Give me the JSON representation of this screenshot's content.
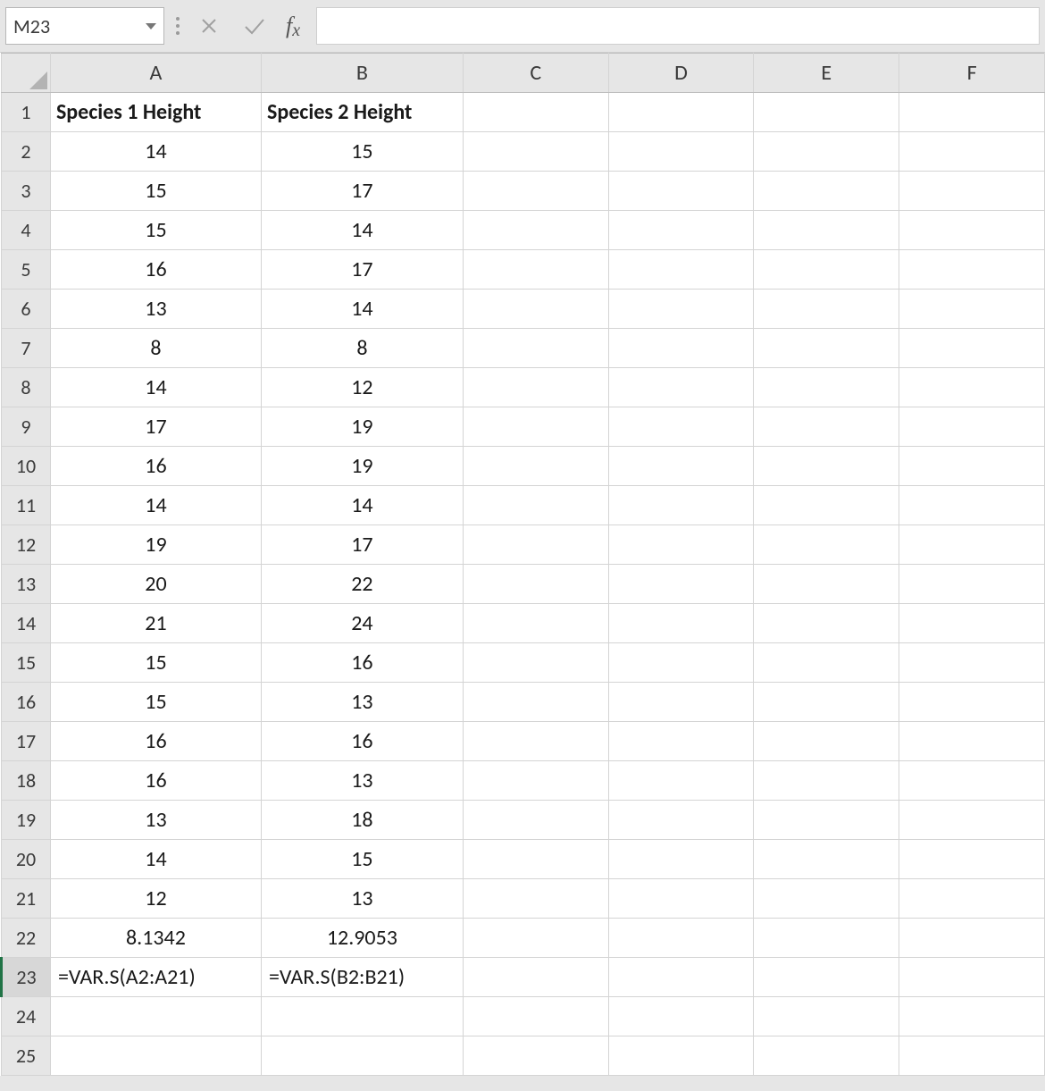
{
  "name_box": "M23",
  "formula_input": "",
  "columns": [
    "A",
    "B",
    "C",
    "D",
    "E",
    "F"
  ],
  "row_numbers": [
    "1",
    "2",
    "3",
    "4",
    "5",
    "6",
    "7",
    "8",
    "9",
    "10",
    "11",
    "12",
    "13",
    "14",
    "15",
    "16",
    "17",
    "18",
    "19",
    "20",
    "21",
    "22",
    "23",
    "24",
    "25"
  ],
  "active_row_index": 22,
  "header_row": {
    "A": "Species 1 Height",
    "B": "Species 2 Height"
  },
  "data": {
    "A": [
      "14",
      "15",
      "15",
      "16",
      "13",
      "8",
      "14",
      "17",
      "16",
      "14",
      "19",
      "20",
      "21",
      "15",
      "15",
      "16",
      "16",
      "13",
      "14",
      "12",
      "8.1342",
      "=VAR.S(A2:A21)",
      "",
      ""
    ],
    "B": [
      "15",
      "17",
      "14",
      "17",
      "14",
      "8",
      "12",
      "19",
      "19",
      "14",
      "17",
      "22",
      "24",
      "16",
      "13",
      "16",
      "13",
      "18",
      "15",
      "13",
      "12.9053",
      "=VAR.S(B2:B21)",
      "",
      ""
    ]
  }
}
